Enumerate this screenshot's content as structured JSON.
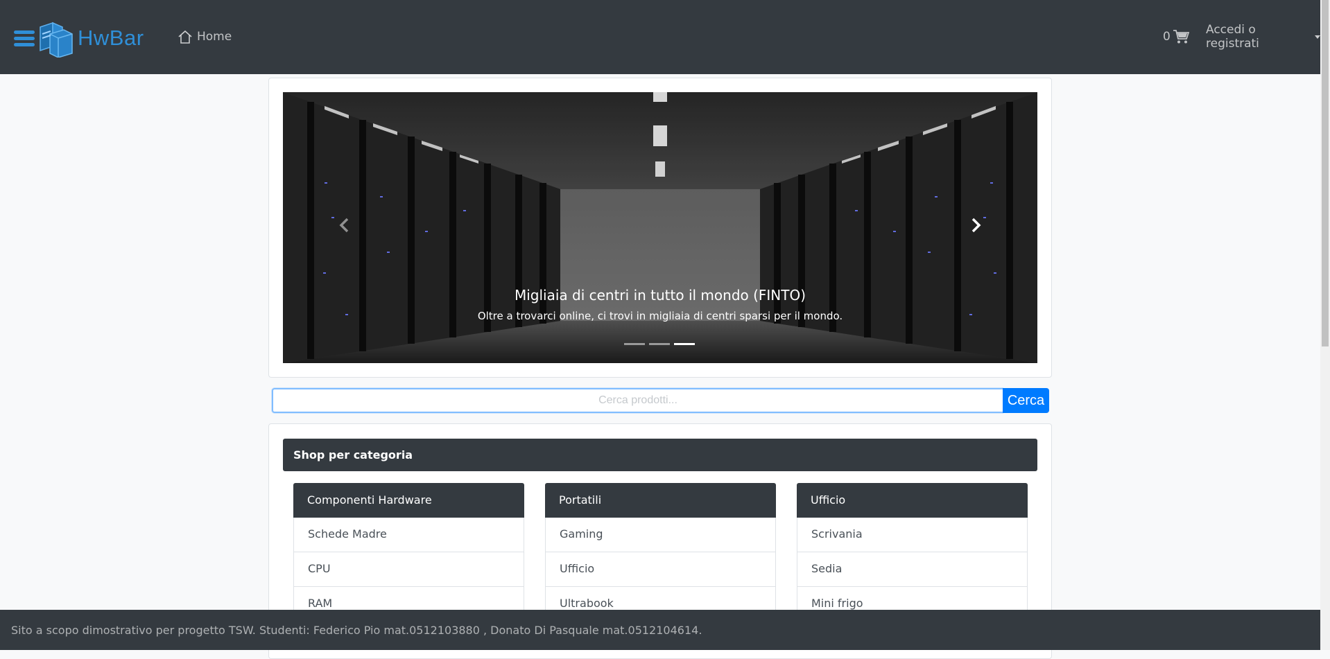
{
  "navbar": {
    "brand": "HwBar",
    "home_label": "Home",
    "cart_count": "0",
    "account_label": "Accedi o registrati"
  },
  "carousel": {
    "caption_title": "Migliaia di centri in tutto il mondo (FINTO)",
    "caption_text": "Oltre a trovarci online, ci trovi in migliaia di centri sparsi per il mondo.",
    "slide_count": 3,
    "active_slide": 3
  },
  "search": {
    "placeholder": "Cerca prodotti...",
    "button_label": "Cerca"
  },
  "categories": {
    "title": "Shop per categoria",
    "columns": [
      {
        "title": "Componenti Hardware",
        "items": [
          "Schede Madre",
          "CPU",
          "RAM"
        ]
      },
      {
        "title": "Portatili",
        "items": [
          "Gaming",
          "Ufficio",
          "Ultrabook"
        ]
      },
      {
        "title": "Ufficio",
        "items": [
          "Scrivania",
          "Sedia",
          "Mini frigo"
        ]
      }
    ]
  },
  "footer": {
    "text": "Sito a scopo dimostrativo per progetto TSW. Studenti: Federico Pio mat.0512103880 , Donato Di Pasquale mat.0512104614."
  },
  "colors": {
    "navbar_bg": "#343a40",
    "brand_blue": "#2f8fd8",
    "primary": "#007bff",
    "page_bg": "#f8f9fa"
  }
}
